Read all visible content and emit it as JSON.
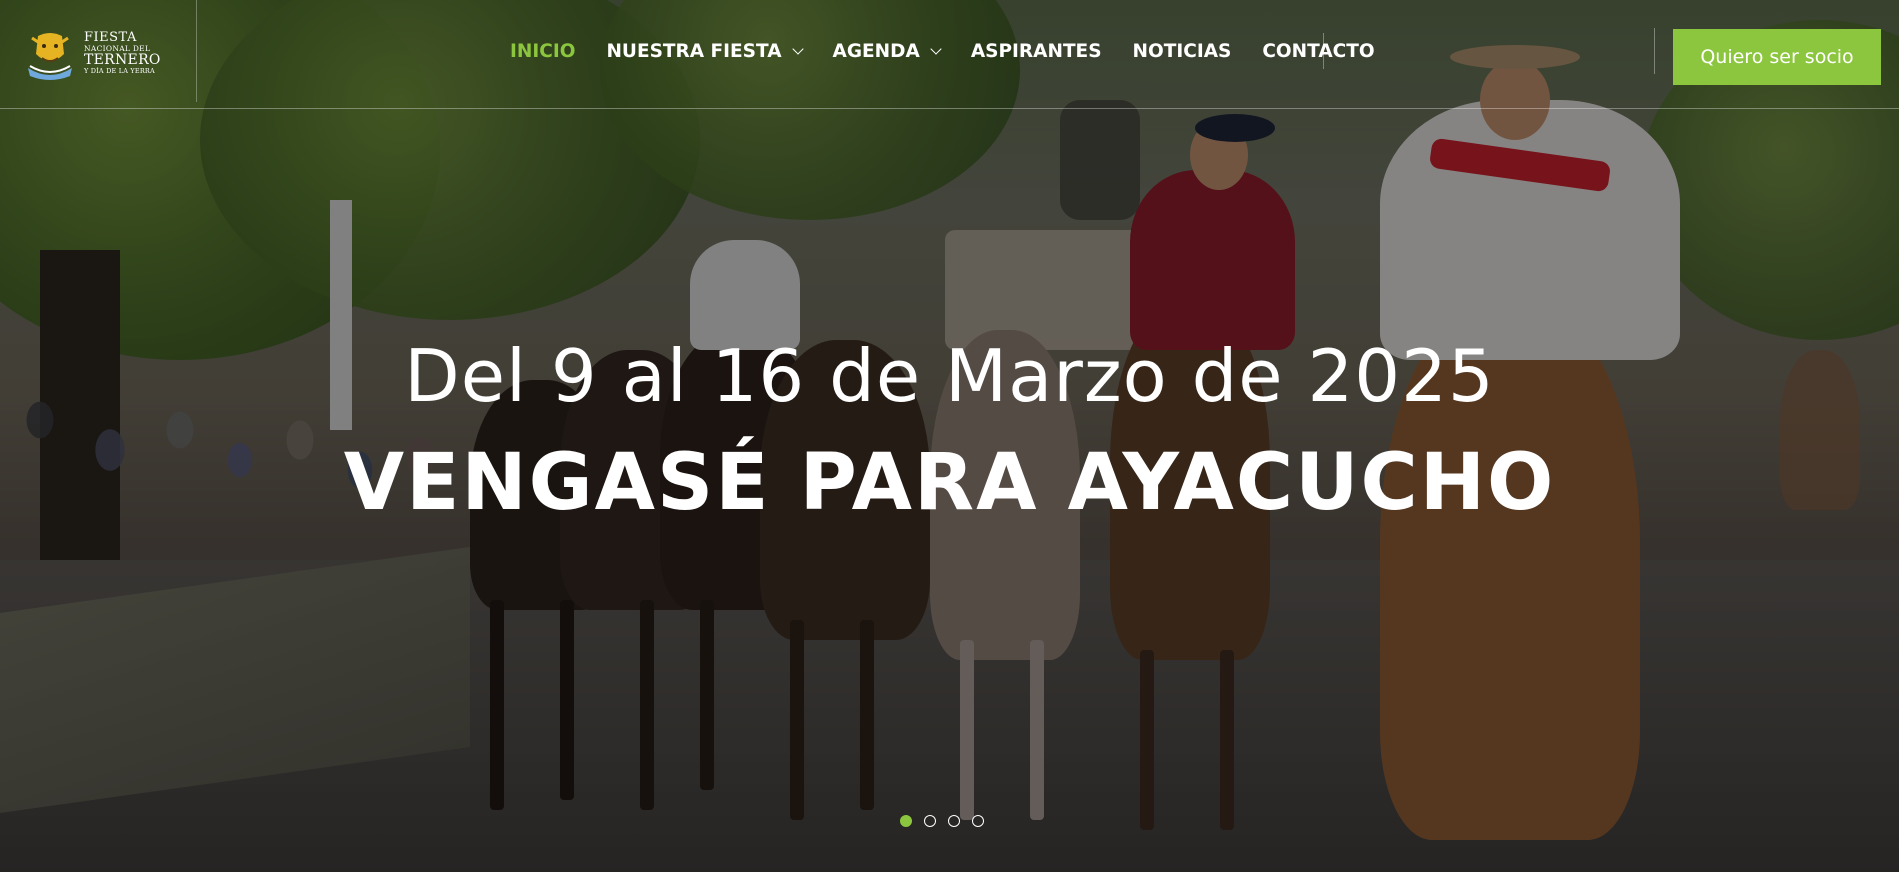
{
  "brand": {
    "logo_line1": "FIESTA",
    "logo_line2": "NACIONAL DEL",
    "logo_line3": "TERNERO",
    "logo_line4": "Y DÍA DE LA YERRA"
  },
  "nav": {
    "items": [
      {
        "label": "INICIO",
        "active": true
      },
      {
        "label": "NUESTRA FIESTA",
        "dropdown": true
      },
      {
        "label": "AGENDA",
        "dropdown": true
      },
      {
        "label": "ASPIRANTES"
      },
      {
        "label": "NOTICIAS"
      },
      {
        "label": "CONTACTO"
      }
    ],
    "cta_label": "Quiero ser socio"
  },
  "hero": {
    "subtitle": "Del 9 al 16 de Marzo de 2025",
    "title": "VENGASÉ PARA AYACUCHO",
    "slides_total": 4,
    "active_slide": 1
  },
  "colors": {
    "accent": "#8cc63f",
    "text": "#ffffff",
    "overlay": "rgba(0,0,0,0.38)"
  }
}
